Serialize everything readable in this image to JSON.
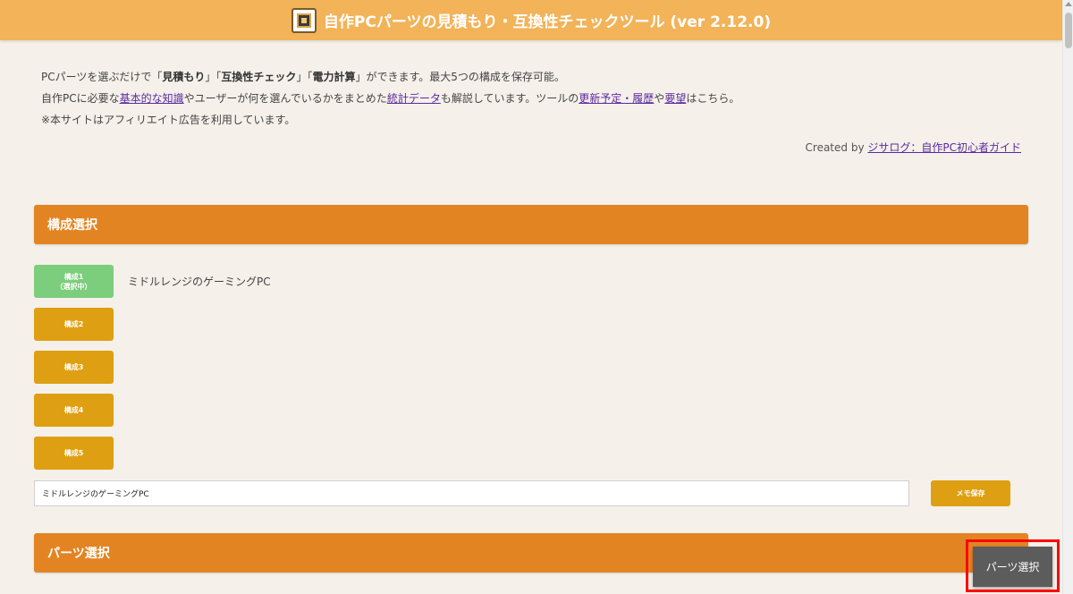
{
  "header": {
    "title": "自作PCパーツの見積もり・互換性チェックツール (ver 2.12.0)",
    "logo_icon": "cpu-chip-icon"
  },
  "intro": {
    "line1": {
      "p1": "PCパーツを選ぶだけで「",
      "b1": "見積もり",
      "p2": "」「",
      "b2": "互換性チェック",
      "p3": "」「",
      "b3": "電力計算",
      "p4": "」ができます。最大5つの構成を保存可能。"
    },
    "line2": {
      "p1": "自作PCに必要な",
      "link1": "基本的な知識",
      "p2": "やユーザーが何を選んでいるかをまとめた",
      "link2": "統計データ",
      "p3": "も解説しています。ツールの",
      "link3": "更新予定・履歴",
      "p4": "や",
      "link4": "要望",
      "p5": "はこちら。"
    },
    "line3": "※本サイトはアフィリエイト広告を利用しています。"
  },
  "credit": {
    "prefix": "Created by",
    "link": "ジサログ：自作PC初心者ガイド"
  },
  "config_section": {
    "title": "構成選択",
    "buttons": [
      {
        "label": "構成1",
        "sub": "（選択中）"
      },
      {
        "label": "構成2"
      },
      {
        "label": "構成3"
      },
      {
        "label": "構成4"
      },
      {
        "label": "構成5"
      }
    ],
    "active_memo": "ミドルレンジのゲーミングPC",
    "memo_value": "ミドルレンジのゲーミングPC",
    "save_label": "メモ保存"
  },
  "parts_section": {
    "title": "パーツ選択"
  },
  "floating_button": {
    "label": "パーツ選択"
  },
  "colors": {
    "header_bg": "#f2b359",
    "section_bg": "#e38423",
    "button_bg": "#df9f12",
    "active_button_bg": "#7ccd7c",
    "floating_bg": "#5c5c5c",
    "highlight": "#ff0000"
  }
}
